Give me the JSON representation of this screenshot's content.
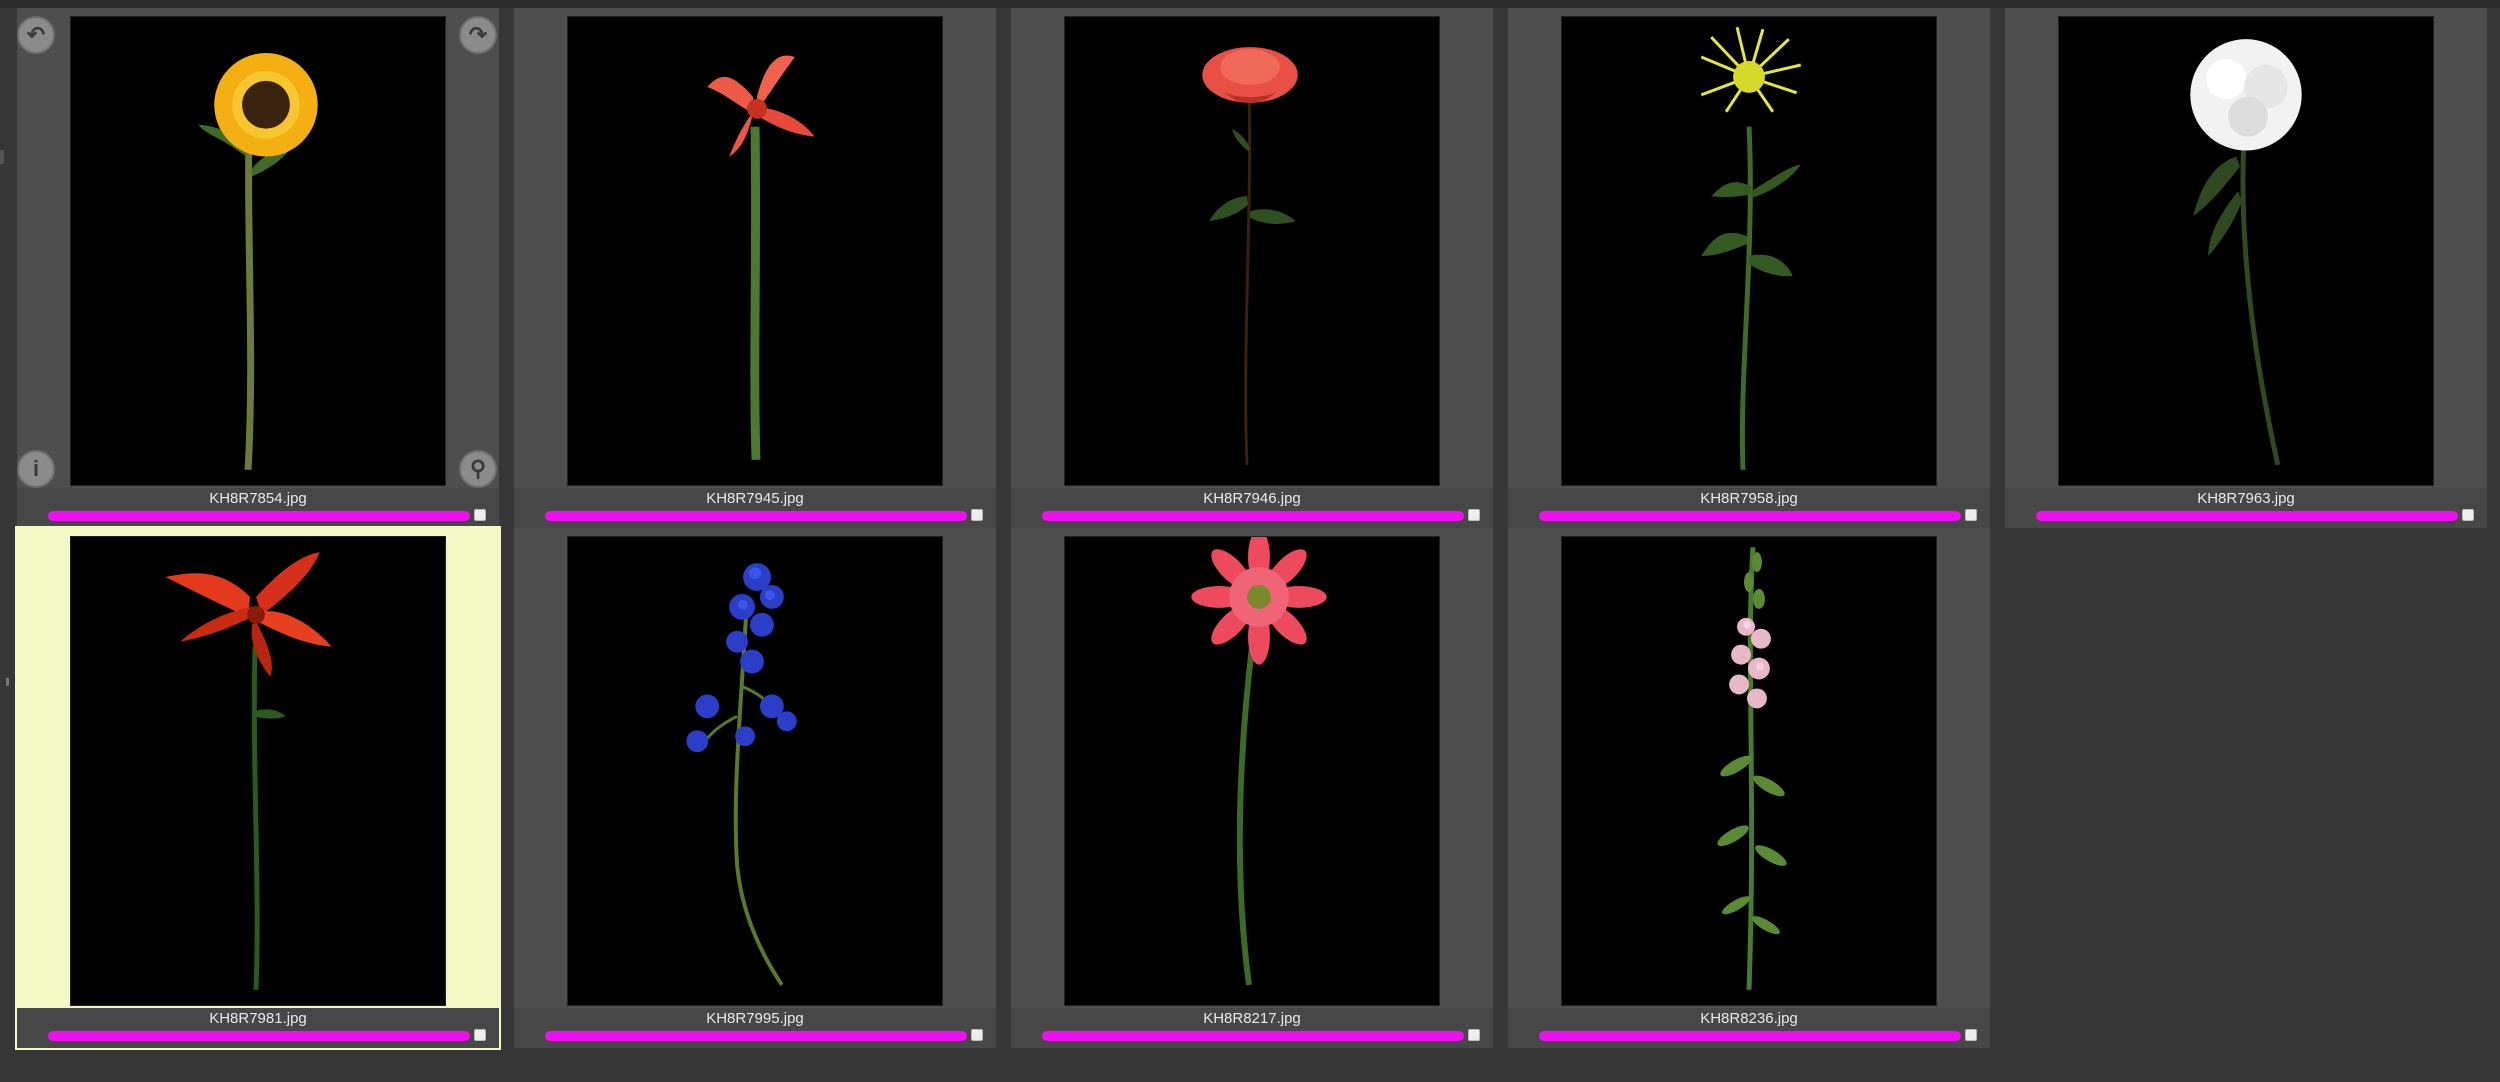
{
  "accent_label_color": "#ee11ee",
  "selected_cell_color": "#f3f8c4",
  "overlay_icons": [
    "rotate-left-icon",
    "rotate-right-icon",
    "info-icon",
    "zoom-icon"
  ],
  "thumbnails": [
    {
      "filename": "KH8R7854.jpg",
      "flower": "sunflower",
      "selected": false
    },
    {
      "filename": "KH8R7945.jpg",
      "flower": "amaryllis",
      "selected": false
    },
    {
      "filename": "KH8R7946.jpg",
      "flower": "rose",
      "selected": false
    },
    {
      "filename": "KH8R7958.jpg",
      "flower": "spider-mum",
      "selected": false
    },
    {
      "filename": "KH8R7963.jpg",
      "flower": "white-chrysanthemum",
      "selected": false
    },
    {
      "filename": "KH8R7981.jpg",
      "flower": "lily",
      "selected": true
    },
    {
      "filename": "KH8R7995.jpg",
      "flower": "delphinium",
      "selected": false
    },
    {
      "filename": "KH8R8217.jpg",
      "flower": "gerbera",
      "selected": false
    },
    {
      "filename": "KH8R8236.jpg",
      "flower": "snapdragon",
      "selected": false
    }
  ]
}
